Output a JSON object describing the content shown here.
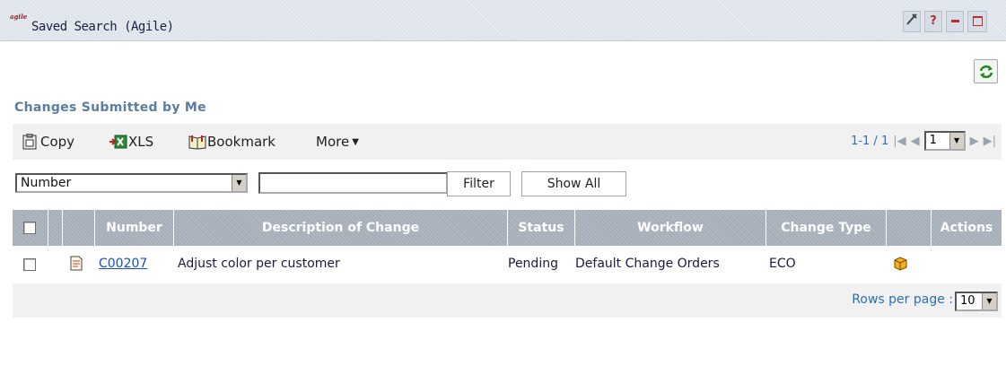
{
  "window": {
    "logo_text": "agile",
    "title": "Saved Search (Agile)",
    "buttons": [
      "wrench-icon",
      "help-icon",
      "minimize-icon",
      "maximize-icon"
    ],
    "help_label": "?"
  },
  "search": {
    "title": "Changes Submitted by Me"
  },
  "toolbar": {
    "copy_label": "Copy",
    "xls_label": "XLS",
    "bookmark_label": "Bookmark",
    "more_label": "More",
    "pager_text": "1-1 / 1",
    "page_value": "1"
  },
  "filter": {
    "field_value": "Number",
    "text_value": "",
    "filter_label": "Filter",
    "show_all_label": "Show All"
  },
  "table": {
    "headers": {
      "number": "Number",
      "description": "Description of Change",
      "status": "Status",
      "workflow": "Workflow",
      "change_type": "Change Type",
      "actions": "Actions"
    },
    "rows": [
      {
        "number": "C00207",
        "description": "Adjust color per customer",
        "status": "Pending",
        "workflow": "Default Change Orders",
        "change_type": "ECO"
      }
    ]
  },
  "footer": {
    "rows_per_page_label": "Rows per page :",
    "rows_per_page_value": "10"
  },
  "colors": {
    "accent": "#5b7ea0",
    "link": "#1a4fc0",
    "header_bg": "#a5aeb8"
  }
}
